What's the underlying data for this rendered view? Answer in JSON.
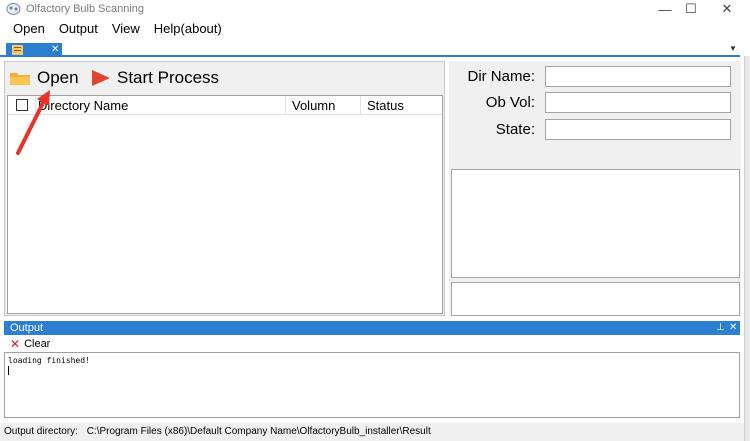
{
  "window": {
    "title": "Olfactory Bulb Scanning",
    "minimize_glyph": "—",
    "maximize_glyph": "☐",
    "close_glyph": "✕"
  },
  "menu": [
    "Open",
    "Output",
    "View",
    "Help(about)"
  ],
  "tabs": {
    "close_glyph": "✕",
    "dropdown_glyph": "▼"
  },
  "toolbar": {
    "open_label": "Open",
    "start_label": "Start Process"
  },
  "list": {
    "columns": [
      "Directory Name",
      "Volumn",
      "Status"
    ],
    "rows": []
  },
  "form": {
    "dir_name_label": "Dir Name:",
    "dir_name_value": "",
    "ob_vol_label": "Ob Vol:",
    "ob_vol_value": "",
    "state_label": "State:",
    "state_value": ""
  },
  "output": {
    "title": "Output",
    "pin_glyph": "⊥",
    "close_glyph": "✕",
    "clear_label": "Clear",
    "log": "loading finished!"
  },
  "status": {
    "label": "Output directory:",
    "path": "C:\\Program Files (x86)\\Default Company Name\\OlfactoryBulb_installer\\Result"
  },
  "colors": {
    "accent": "#2c7fd0",
    "panel": "#f0f0f0",
    "folder": "#f5b335",
    "play": "#e0452f",
    "annotation_arrow": "#e8332a"
  }
}
